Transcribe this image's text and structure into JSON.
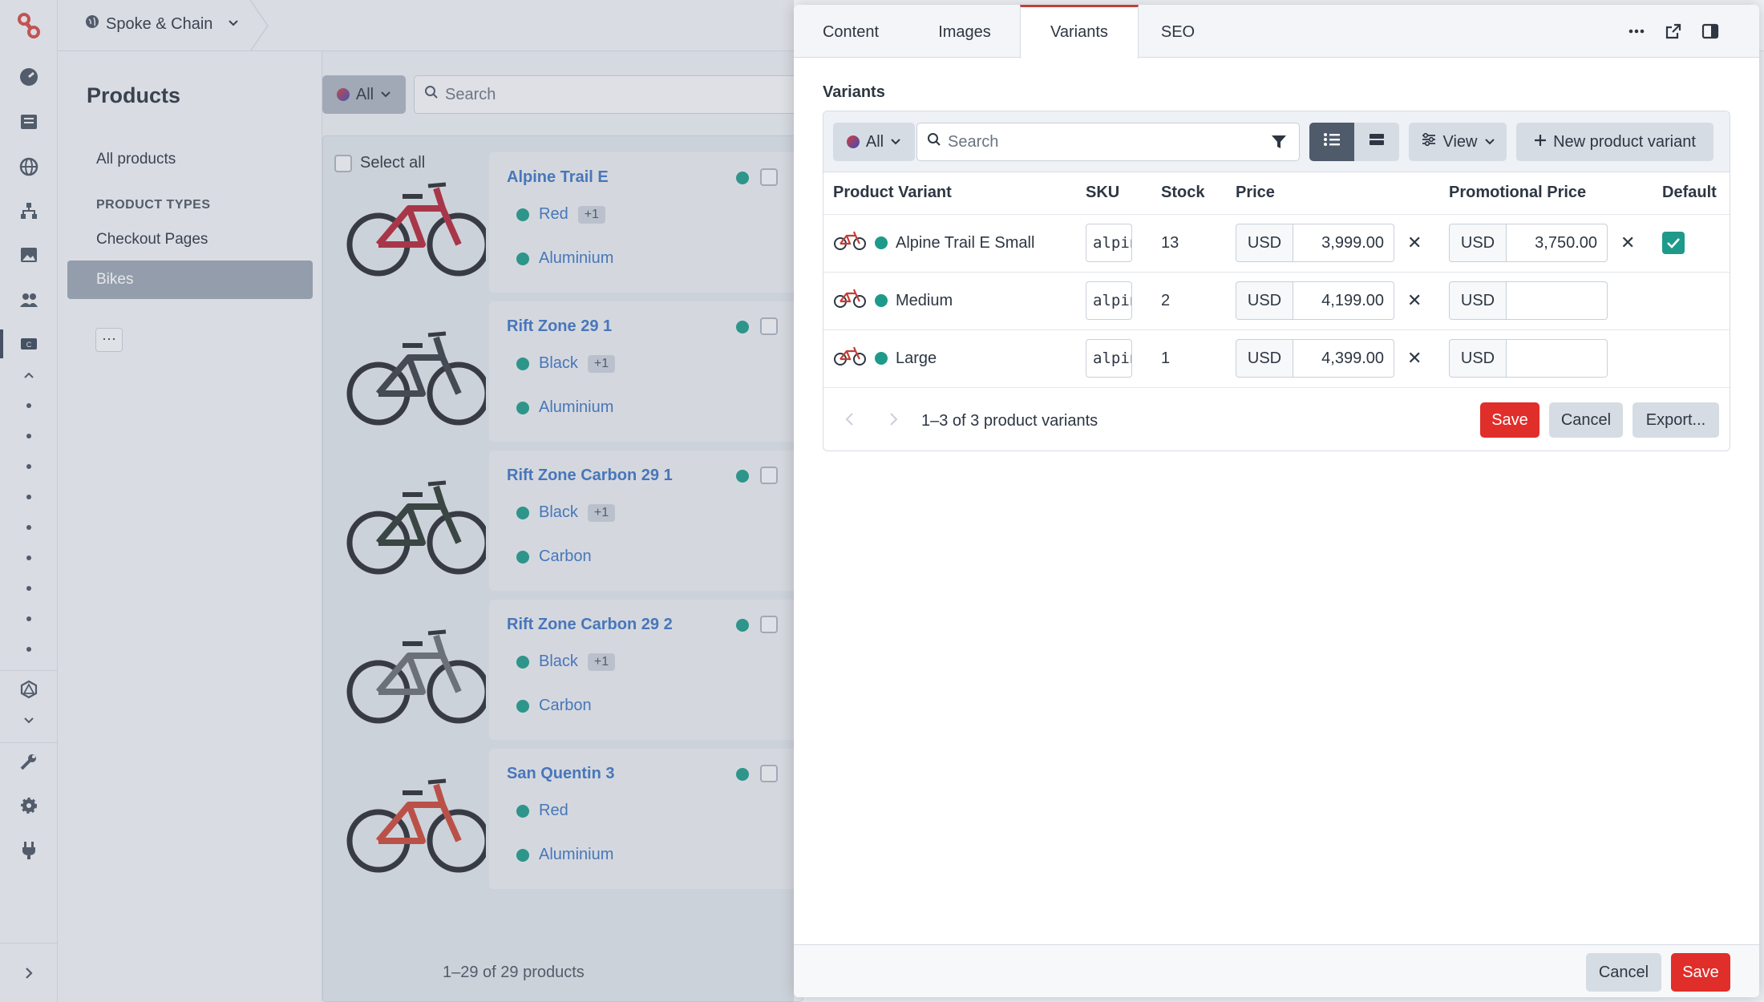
{
  "topbar": {
    "site_name": "Spoke & Chain"
  },
  "nav": {
    "title": "Products",
    "all_products": "All products",
    "section_header": "PRODUCT TYPES",
    "items": [
      "Checkout Pages",
      "Bikes"
    ],
    "more": "···"
  },
  "list": {
    "filter_label": "All",
    "search_placeholder": "Search",
    "select_all": "Select all",
    "products": [
      {
        "name": "Alpine Trail E",
        "color": "Red",
        "extra": "+1",
        "material": "Aluminium",
        "frame": "#b3263a"
      },
      {
        "name": "Rift Zone 29 1",
        "color": "Black",
        "extra": "+1",
        "material": "Aluminium",
        "frame": "#3a3f48"
      },
      {
        "name": "Rift Zone Carbon 29 1",
        "color": "Black",
        "extra": "+1",
        "material": "Carbon",
        "frame": "#2b3a34"
      },
      {
        "name": "Rift Zone Carbon 29 2",
        "color": "Black",
        "extra": "+1",
        "material": "Carbon",
        "frame": "#6a6e74"
      },
      {
        "name": "San Quentin 3",
        "color": "Red",
        "extra": "",
        "material": "Aluminium",
        "frame": "#c8473a"
      }
    ],
    "footer": "1–29 of 29 products"
  },
  "drawer": {
    "tabs": [
      "Content",
      "Images",
      "Variants",
      "SEO"
    ],
    "active_tab": "Variants",
    "icons": [
      "more-icon",
      "external-link-icon",
      "panel-toggle-icon"
    ],
    "section_label": "Variants",
    "toolbar": {
      "filter_label": "All",
      "search_placeholder": "Search",
      "view_label": "View",
      "new_variant_label": "New product variant"
    },
    "columns": [
      "Product Variant",
      "SKU",
      "Stock",
      "Price",
      "Promotional Price",
      "Default"
    ],
    "variants": [
      {
        "name": "Alpine Trail E Small",
        "sku": "alpine-trail-e-small",
        "stock": "13",
        "price_currency": "USD",
        "price": "3,999.00",
        "promo_currency": "USD",
        "promo_price": "3,750.00",
        "is_default": true
      },
      {
        "name": "Medium",
        "sku": "alpine-trail-e-medium",
        "stock": "2",
        "price_currency": "USD",
        "price": "4,199.00",
        "promo_currency": "USD",
        "promo_price": "",
        "is_default": false
      },
      {
        "name": "Large",
        "sku": "alpine-trail-e-large",
        "stock": "1",
        "price_currency": "USD",
        "price": "4,399.00",
        "promo_currency": "USD",
        "promo_price": "",
        "is_default": false
      }
    ],
    "pagination": "1–3 of 3 product variants",
    "save_label": "Save",
    "cancel_label": "Cancel",
    "export_label": "Export...",
    "footer_cancel": "Cancel",
    "footer_save": "Save"
  },
  "colors": {
    "accent_red": "#e02e2a",
    "status_teal": "#1e9a8a",
    "link_blue": "#3d74c4"
  }
}
